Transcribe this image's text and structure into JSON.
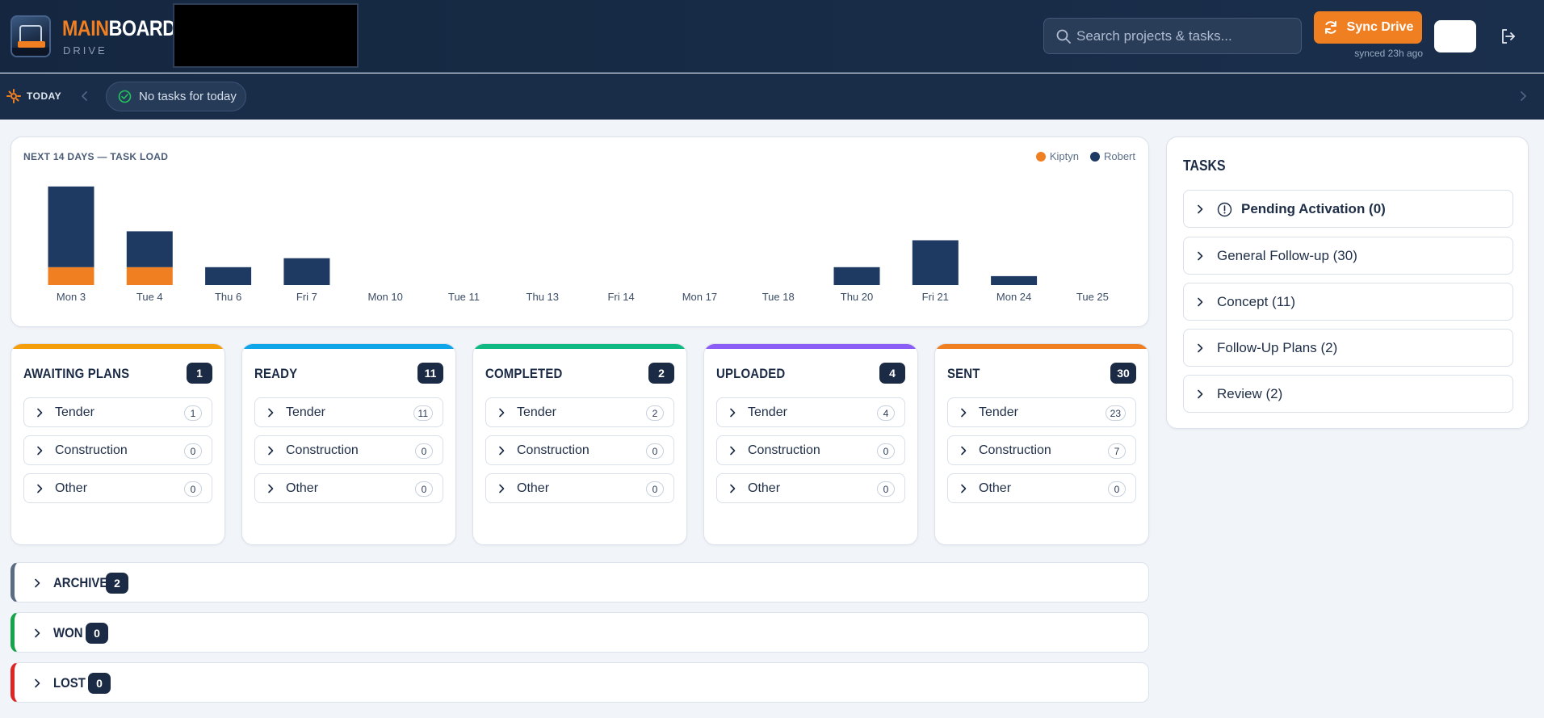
{
  "header": {
    "brand_accent": "MAIN",
    "brand_rest": "BOARD",
    "brand_sub": "DRIVE",
    "search_placeholder": "Search projects & tasks...",
    "sync_label": "Sync Drive",
    "synced_text": "synced 23h ago"
  },
  "today": {
    "label": "TODAY",
    "pill_text": "No tasks for today"
  },
  "chart": {
    "title": "NEXT 14 DAYS — TASK LOAD",
    "legend": [
      {
        "name": "Kiptyn",
        "color": "#f07f22"
      },
      {
        "name": "Robert",
        "color": "#1e3a63"
      }
    ]
  },
  "chart_data": {
    "type": "bar",
    "stacked": true,
    "title": "NEXT 14 DAYS — TASK LOAD",
    "categories": [
      "Mon 3",
      "Tue 4",
      "Thu 6",
      "Fri 7",
      "Mon 10",
      "Tue 11",
      "Thu 13",
      "Fri 14",
      "Mon 17",
      "Tue 18",
      "Thu 20",
      "Fri 21",
      "Mon 24",
      "Tue 25"
    ],
    "series": [
      {
        "name": "Kiptyn",
        "color": "#f07f22",
        "values": [
          2,
          2,
          0,
          0,
          0,
          0,
          0,
          0,
          0,
          0,
          0,
          0,
          0,
          0
        ]
      },
      {
        "name": "Robert",
        "color": "#1e3a63",
        "values": [
          9,
          4,
          2,
          3,
          0,
          0,
          0,
          0,
          0,
          0,
          2,
          5,
          1,
          0
        ]
      }
    ],
    "ylim": [
      0,
      11
    ],
    "grid": false,
    "legend_position": "top-right"
  },
  "columns": [
    {
      "title": "AWAITING PLANS",
      "count": "1",
      "color": "#f59e0b",
      "rows": [
        {
          "label": "Tender",
          "count": "1"
        },
        {
          "label": "Construction",
          "count": "0"
        },
        {
          "label": "Other",
          "count": "0"
        }
      ]
    },
    {
      "title": "READY",
      "count": "11",
      "color": "#0ea5e9",
      "rows": [
        {
          "label": "Tender",
          "count": "11"
        },
        {
          "label": "Construction",
          "count": "0"
        },
        {
          "label": "Other",
          "count": "0"
        }
      ]
    },
    {
      "title": "COMPLETED",
      "count": "2",
      "color": "#10b981",
      "rows": [
        {
          "label": "Tender",
          "count": "2"
        },
        {
          "label": "Construction",
          "count": "0"
        },
        {
          "label": "Other",
          "count": "0"
        }
      ]
    },
    {
      "title": "UPLOADED",
      "count": "4",
      "color": "#8b5cf6",
      "rows": [
        {
          "label": "Tender",
          "count": "4"
        },
        {
          "label": "Construction",
          "count": "0"
        },
        {
          "label": "Other",
          "count": "0"
        }
      ]
    },
    {
      "title": "SENT",
      "count": "30",
      "color": "#f07f22",
      "rows": [
        {
          "label": "Tender",
          "count": "23"
        },
        {
          "label": "Construction",
          "count": "7"
        },
        {
          "label": "Other",
          "count": "0"
        }
      ]
    }
  ],
  "archive": {
    "archive": {
      "label": "ARCHIVE",
      "count": "2",
      "color": "#5b6b82"
    },
    "won": {
      "label": "WON",
      "count": "0",
      "color": "#16a34a"
    },
    "lost": {
      "label": "LOST",
      "count": "0",
      "color": "#dc2626"
    }
  },
  "tasks": {
    "title": "TASKS",
    "items": [
      {
        "label": "Pending Activation (0)"
      },
      {
        "label": "General Follow-up (30)"
      },
      {
        "label": "Concept (11)"
      },
      {
        "label": "Follow-Up Plans (2)"
      },
      {
        "label": "Review (2)"
      }
    ]
  }
}
